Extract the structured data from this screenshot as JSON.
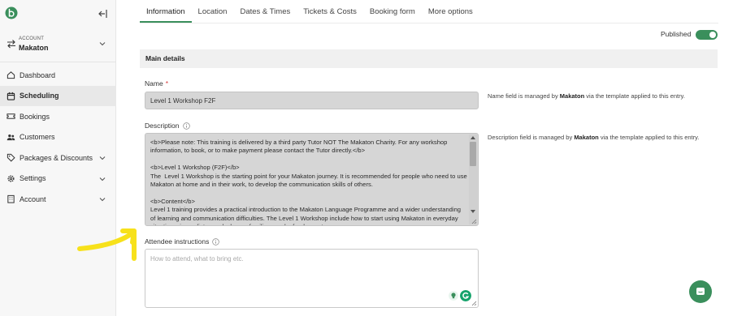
{
  "app": {
    "accent": "#3a8f5c"
  },
  "sidebar": {
    "account_label": "ACCOUNT",
    "account_name": "Makaton",
    "items": [
      {
        "label": "Dashboard",
        "icon": "home-icon"
      },
      {
        "label": "Scheduling",
        "icon": "calendar-icon",
        "active": true
      },
      {
        "label": "Bookings",
        "icon": "ticket-icon"
      },
      {
        "label": "Customers",
        "icon": "people-icon"
      },
      {
        "label": "Packages & Discounts",
        "icon": "tag-icon",
        "expandable": true
      },
      {
        "label": "Settings",
        "icon": "gear-icon",
        "expandable": true
      },
      {
        "label": "Account",
        "icon": "building-icon",
        "expandable": true
      }
    ]
  },
  "tabs": [
    "Information",
    "Location",
    "Dates & Times",
    "Tickets & Costs",
    "Booking form",
    "More options"
  ],
  "published_label": "Published",
  "section_title": "Main details",
  "name_field": {
    "label": "Name",
    "required_mark": "*",
    "value": "Level 1 Workshop F2F",
    "note_prefix": "Name field is managed by ",
    "note_brand": "Makaton",
    "note_suffix": " via the template applied to this entry."
  },
  "description_field": {
    "label": "Description",
    "value": "<b>Please note: This training is delivered by a third party Tutor NOT The Makaton Charity. For any workshop information, to book, or to make payment please contact the Tutor directly.</b>\n\n<b>Level 1 Workshop (F2F)</b>\nThe  Level 1 Workshop is the starting point for your Makaton journey. It is recommended for people who need to use Makaton at home and in their work, to develop the communication skills of others.\n\n<b>Content</b>\nLevel 1 training provides a practical introduction to the Makaton Language Programme and a wider understanding of learning and communication difficulties. The Level 1 Workshop include how to start using Makaton in everyday situations: immediate needs, home, familiar people, food, events",
    "note_prefix": "Description field is managed by ",
    "note_brand": "Makaton",
    "note_suffix": " via the template applied to this entry."
  },
  "attendee_field": {
    "label": "Attendee instructions",
    "placeholder": "How to attend, what to bring etc."
  }
}
